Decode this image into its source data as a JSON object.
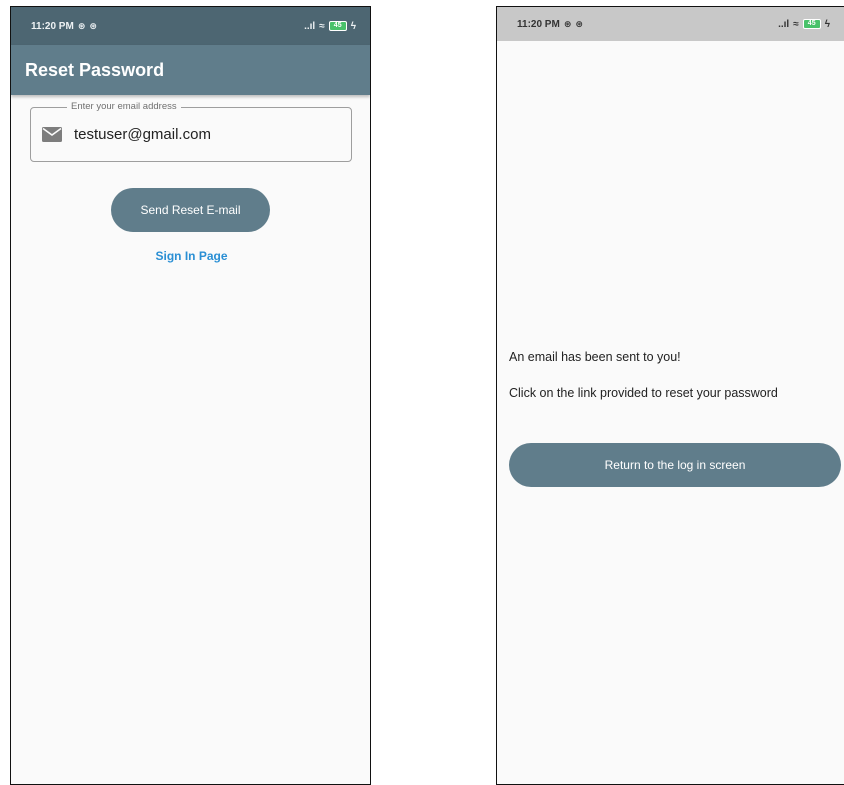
{
  "left_screen": {
    "status_bar": {
      "time": "11:20 PM",
      "signal": "..ıl",
      "wifi": "≈",
      "battery": "45"
    },
    "appbar": {
      "title": "Reset Password"
    },
    "email_field": {
      "label": "Enter your email address",
      "value": "testuser@gmail.com"
    },
    "send_button": {
      "label": "Send Reset E-mail"
    },
    "sign_in_link": {
      "label": "Sign In Page"
    }
  },
  "right_screen": {
    "status_bar": {
      "time": "11:20 PM",
      "signal": "..ıl",
      "wifi": "≈",
      "battery": "45"
    },
    "message_1": "An email has been sent to you!",
    "message_2": "Click on the link provided to reset your password",
    "return_button": {
      "label": "Return to the log in screen"
    }
  },
  "colors": {
    "appbar": "#607d8b",
    "button": "#607d8b",
    "link": "#2a8fd4",
    "background": "#fafafa"
  }
}
